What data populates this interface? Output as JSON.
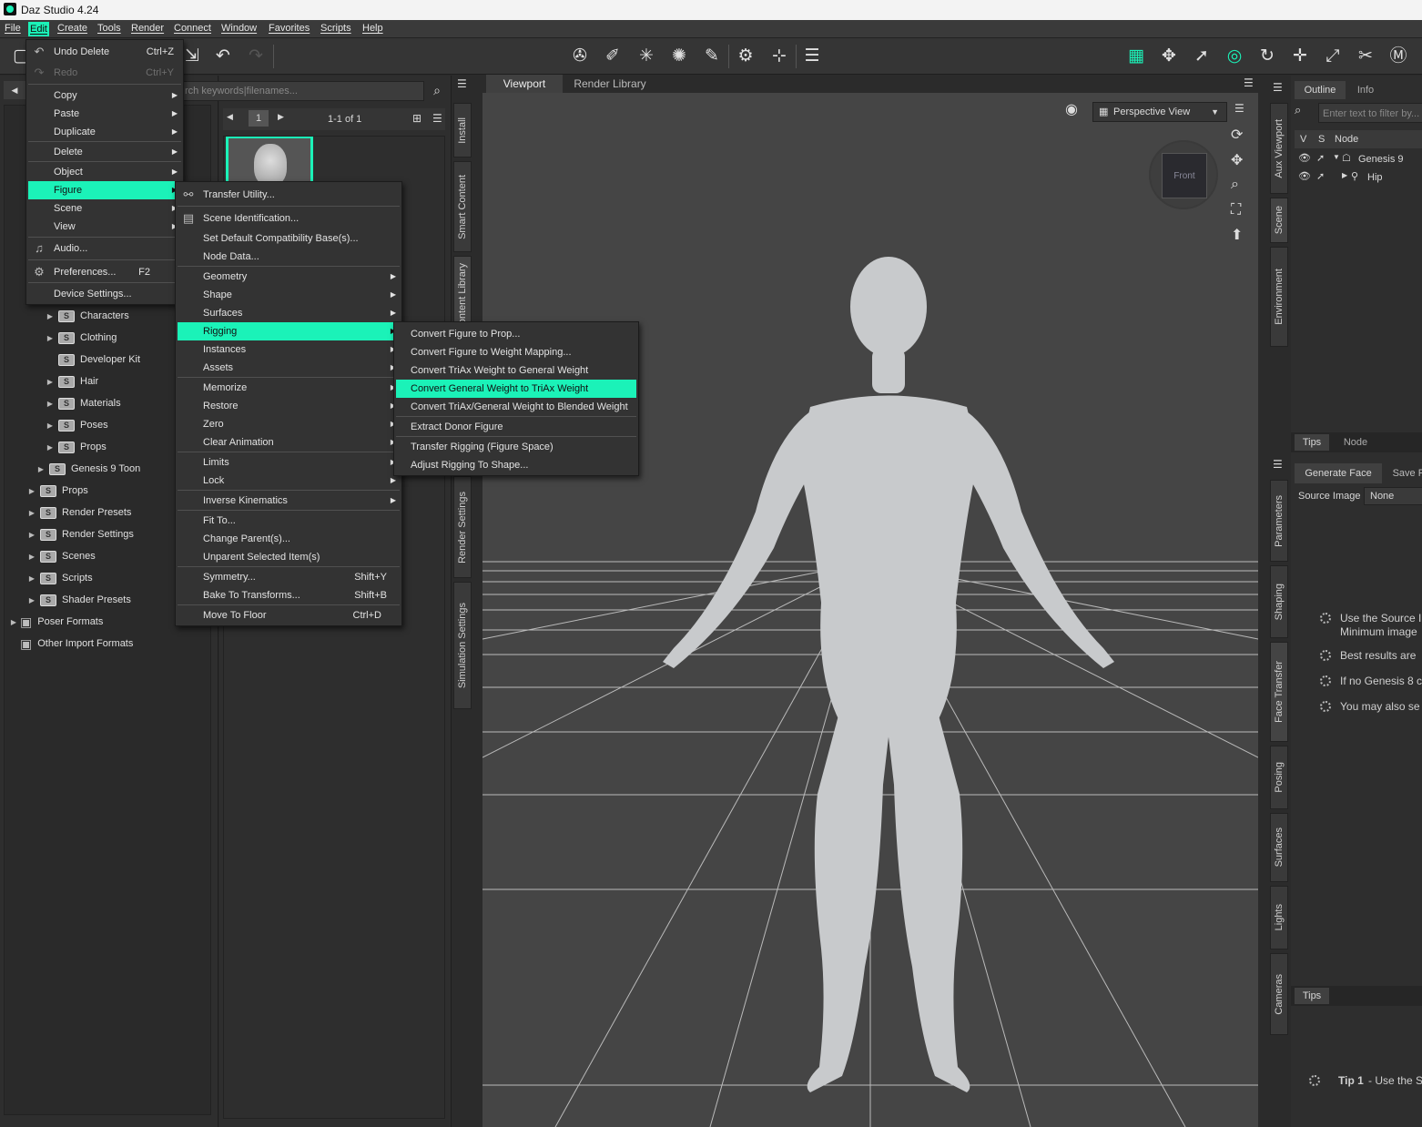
{
  "app": {
    "title": "Daz Studio 4.24"
  },
  "menubar": [
    "File",
    "Edit",
    "Create",
    "Tools",
    "Render",
    "Connect",
    "Window",
    "Favorites",
    "Scripts",
    "Help"
  ],
  "edit_menu": [
    {
      "label": "Undo Delete",
      "shortcut": "Ctrl+Z"
    },
    {
      "label": "Redo",
      "shortcut": "Ctrl+Y"
    },
    {
      "label": "Copy"
    },
    {
      "label": "Paste"
    },
    {
      "label": "Duplicate"
    },
    {
      "label": "Delete"
    },
    {
      "label": "Object"
    },
    {
      "label": "Figure"
    },
    {
      "label": "Scene"
    },
    {
      "label": "View"
    },
    {
      "label": "Audio..."
    },
    {
      "label": "Preferences...",
      "shortcut": "F2"
    },
    {
      "label": "Device Settings..."
    }
  ],
  "figure_menu": [
    "Transfer Utility...",
    "Scene Identification...",
    "Set Default Compatibility Base(s)...",
    "Node Data...",
    "Geometry",
    "Shape",
    "Surfaces",
    "Rigging",
    "Instances",
    "Assets",
    "Memorize",
    "Restore",
    "Zero",
    "Clear Animation",
    "Limits",
    "Lock",
    "Inverse Kinematics",
    "Fit To...",
    "Change Parent(s)...",
    "Unparent Selected Item(s)",
    "Symmetry...",
    "Bake To Transforms...",
    "Move To Floor"
  ],
  "figure_shortcuts": {
    "symmetry": "Shift+Y",
    "bake": "Shift+B",
    "floor": "Ctrl+D"
  },
  "rigging_menu": [
    "Convert Figure to Prop...",
    "Convert Figure to Weight Mapping...",
    "Convert TriAx Weight to General Weight",
    "Convert General Weight to TriAx Weight",
    "Convert TriAx/General Weight to Blended Weight",
    "Extract Donor Figure",
    "Transfer Rigging (Figure Space)",
    "Adjust Rigging To Shape..."
  ],
  "content_tree": [
    "Characters",
    "Clothing",
    "Developer Kit",
    "Hair",
    "Materials",
    "Poses",
    "Props",
    "Genesis 9 Toon",
    "Props",
    "Render Presets",
    "Render Settings",
    "Scenes",
    "Scripts",
    "Shader Presets",
    "Poser Formats",
    "Other Import Formats"
  ],
  "content_pane": {
    "search_placeholder": "rch keywords|filenames...",
    "page": "1",
    "pager": "1-1 of 1"
  },
  "left_vtabs": [
    "Install",
    "Smart Content",
    "Content Library",
    "Render Settings",
    "Simulation Settings"
  ],
  "viewport": {
    "tabs": [
      "Viewport",
      "Render Library"
    ],
    "view": "Perspective View",
    "cube_label": "Front"
  },
  "right_vtabs": [
    "Aux Viewport",
    "Scene",
    "Environment",
    "Parameters",
    "Shaping",
    "Face Transfer",
    "Posing",
    "Surfaces",
    "Lights",
    "Cameras"
  ],
  "scene": {
    "tabs": [
      "Outline",
      "Info"
    ],
    "filter_placeholder": "Enter text to filter by...",
    "cols": [
      "V",
      "S",
      "Node"
    ],
    "nodes": [
      "Genesis 9",
      "Hip"
    ]
  },
  "tips_tabs": [
    "Tips",
    "Node"
  ],
  "face_transfer": {
    "tabs": [
      "Generate Face",
      "Save F"
    ],
    "source_label": "Source Image :",
    "source_value": "None",
    "tips": [
      "Use the Source I",
      "Minimum image",
      "Best results are",
      "If no Genesis 8 c",
      "You may also se"
    ]
  },
  "bottom_tips": {
    "tab": "Tips",
    "tip_bold": "Tip 1",
    "tip_text": " - Use the S"
  },
  "colors": {
    "accent": "#1bf2b8",
    "menu_bg": "#333333",
    "viewport_bg": "#454545"
  }
}
